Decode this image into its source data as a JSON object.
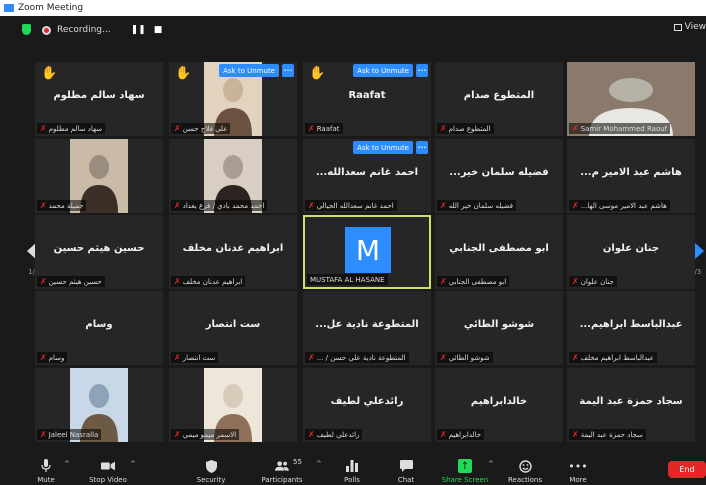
{
  "window": {
    "title": "Zoom Meeting"
  },
  "topbar": {
    "recording_label": "Recording...",
    "pause_label": "❚❚",
    "stop_label": "■",
    "view_label": "View"
  },
  "pagination": {
    "left": "1/3",
    "right": "1/3"
  },
  "tiles": [
    {
      "center_name": "سهاد سالم مطلوم",
      "label": "سهاد سالم مطلوم",
      "hand": true,
      "photo": null
    },
    {
      "center_name": "",
      "label": "علي فلاح حسن",
      "hand": true,
      "photo": "man-beard",
      "unmute": "Ask to Unmute"
    },
    {
      "center_name": "Raafat",
      "label": "Raafat",
      "hand": true,
      "photo": null,
      "unmute": "Ask to Unmute"
    },
    {
      "center_name": "المتطوع صدام",
      "label": "المتطوع صدام",
      "hand": false,
      "photo": null
    },
    {
      "center_name": "",
      "label": "Samir Mohammed Raouf",
      "hand": false,
      "photo": "old-man"
    },
    {
      "center_name": "",
      "label": "جميلة محمد",
      "hand": false,
      "photo": "woman"
    },
    {
      "center_name": "",
      "label": "احمد محمد بادي / فرع بغداد",
      "hand": false,
      "photo": "young-man"
    },
    {
      "center_name": "...احمد غانم سعدالله",
      "label": "احمد غانم سعدالله الحيالي",
      "hand": false,
      "photo": null,
      "unmute": "Ask to Unmute"
    },
    {
      "center_name": "...فضيله سلمان خير",
      "label": "فضيله سلمان خير الله",
      "hand": false,
      "photo": null
    },
    {
      "center_name": "...هاشم عبد الامير م",
      "label": "...هاشم عبد الامير موسى الها",
      "hand": false,
      "photo": null
    },
    {
      "center_name": "حسين هيثم حسين",
      "label": "حسين هيثم حسين",
      "hand": false,
      "photo": null
    },
    {
      "center_name": "ابراهيم عدنان مخلف",
      "label": "ابراهيم عدنان مخلف",
      "hand": false,
      "photo": null
    },
    {
      "center_name": "",
      "label": "MUSTAFA AL HASANE",
      "hand": false,
      "photo": null,
      "avatar": "M",
      "active": true
    },
    {
      "center_name": "ابو مصطفى الجنابي",
      "label": "ابو مصطفى الجنابي",
      "hand": false,
      "photo": null
    },
    {
      "center_name": "جنان علوان",
      "label": "جنان علوان",
      "hand": false,
      "photo": null
    },
    {
      "center_name": "وسام",
      "label": "وسام",
      "hand": false,
      "photo": null
    },
    {
      "center_name": "ست انتصار",
      "label": "ست انتصار",
      "hand": false,
      "photo": null
    },
    {
      "center_name": "...المتطوعة نادية عل",
      "label": "... / المتطوعة نادية علي حسن",
      "hand": false,
      "photo": null
    },
    {
      "center_name": "شوشو الطائي",
      "label": "شوشو الطائي",
      "hand": false,
      "photo": null
    },
    {
      "center_name": "...عبدالباسط ابراهيم",
      "label": "عبدالباسط ابراهيم مخلف",
      "hand": false,
      "photo": null
    },
    {
      "center_name": "",
      "label": "Jaleel Nasralla",
      "hand": false,
      "photo": "man-outdoor"
    },
    {
      "center_name": "",
      "label": "الاسمر ميمو ميمي",
      "hand": false,
      "photo": "man-light"
    },
    {
      "center_name": "رائدعلي لطيف",
      "label": "رائدعلي لطيف",
      "hand": false,
      "photo": null
    },
    {
      "center_name": "خالدابراهيم",
      "label": "خالدابراهيم",
      "hand": false,
      "photo": null
    },
    {
      "center_name": "سجاد حمزة عبد اليمة",
      "label": "سجاد حمزة عبد اليمة",
      "hand": false,
      "photo": null
    }
  ],
  "toolbar": {
    "mute": "Mute",
    "stop_video": "Stop Video",
    "security": "Security",
    "participants": "Participants",
    "participants_count": "55",
    "polls": "Polls",
    "chat": "Chat",
    "share_screen": "Share Screen",
    "reactions": "Reactions",
    "more": "More",
    "end": "End"
  },
  "colors": {
    "accent": "#2d8cff",
    "mute_red": "#e02828",
    "share_green": "#23d959",
    "hand_yellow": "#f5c518",
    "active_border": "#c9e069"
  }
}
